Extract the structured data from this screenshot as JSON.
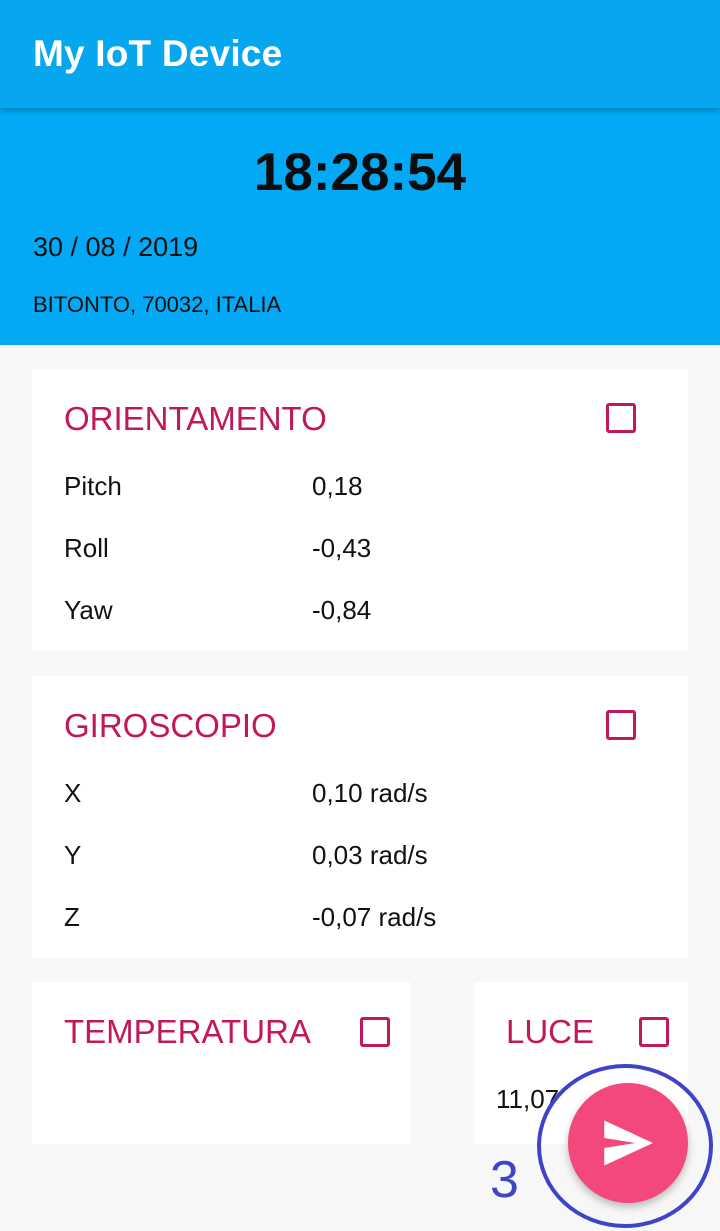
{
  "app": {
    "title": "My IoT Device"
  },
  "header": {
    "time": "18:28:54",
    "date": "30 / 08 / 2019",
    "location": "BITONTO, 70032, ITALIA"
  },
  "orientation": {
    "title": "ORIENTAMENTO",
    "checked": false,
    "rows": [
      {
        "label": "Pitch",
        "value": "0,18"
      },
      {
        "label": "Roll",
        "value": "-0,43"
      },
      {
        "label": "Yaw",
        "value": "-0,84"
      }
    ]
  },
  "gyroscope": {
    "title": "GIROSCOPIO",
    "checked": false,
    "rows": [
      {
        "label": "X",
        "value": "0,10 rad/s"
      },
      {
        "label": "Y",
        "value": "0,03 rad/s"
      },
      {
        "label": "Z",
        "value": "-0,07 rad/s"
      }
    ]
  },
  "temperature": {
    "title": "TEMPERATURA",
    "checked": false
  },
  "light": {
    "title": "LUCE",
    "checked": false,
    "value": "11,07"
  },
  "fab": {
    "icon": "send-icon"
  },
  "annotation": {
    "label": "3"
  },
  "colors": {
    "appbar": "#07a7ef",
    "header": "#03a9f4",
    "accent": "#c2185b",
    "fab": "#f2487c",
    "annotation": "#3f43c8"
  }
}
